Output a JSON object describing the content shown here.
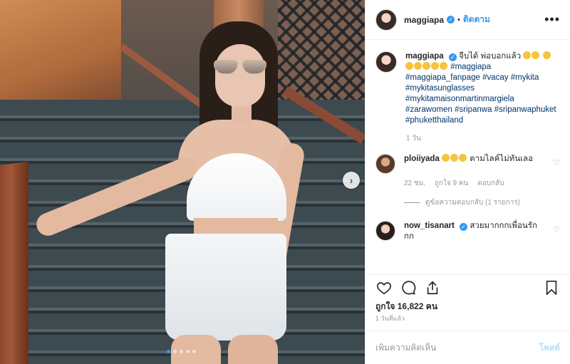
{
  "header": {
    "username": "maggiapa",
    "separator": "•",
    "follow_label": "ติดตาม",
    "more_label": "•••"
  },
  "caption": {
    "username": "maggiapa",
    "text": "จีบได้ พ่อบอกแล้ว",
    "hashtags": [
      "#maggiapa",
      "#maggiapa_fanpage",
      "#vacay",
      "#mykita",
      "#mykitasunglasses",
      "#mykitamaisonmartinmargiela",
      "#zarawomen",
      "#sripanwa",
      "#sripanwaphuket",
      "#phuketthailand"
    ],
    "time": "1 วัน"
  },
  "comments": [
    {
      "username": "ploiiyada",
      "text": "ตามไลค์ไม่ทันเลอ",
      "time": "22 ชม.",
      "likes": "ถูกใจ 9 คน",
      "reply_label": "ตอบกลับ",
      "view_replies": "ดูข้อความตอบกลับ (1 รายการ)"
    },
    {
      "username": "now_tisanart",
      "text": "สวยมากกกเพื่อนรักกก"
    }
  ],
  "likes_text": "ถูกใจ 16,822 คน",
  "date_text": "1 วันที่แล้ว",
  "add_comment": {
    "placeholder": "เพิ่มความคิดเห็น",
    "post_label": "โพสต์"
  },
  "carousel": {
    "count": 5,
    "active_index": 0,
    "next_icon": "chevron-right-icon"
  },
  "colors": {
    "accent": "#3897f0",
    "text": "#262626",
    "muted": "#999999",
    "hashtag": "#003569",
    "post_disabled": "#b2dffc"
  }
}
